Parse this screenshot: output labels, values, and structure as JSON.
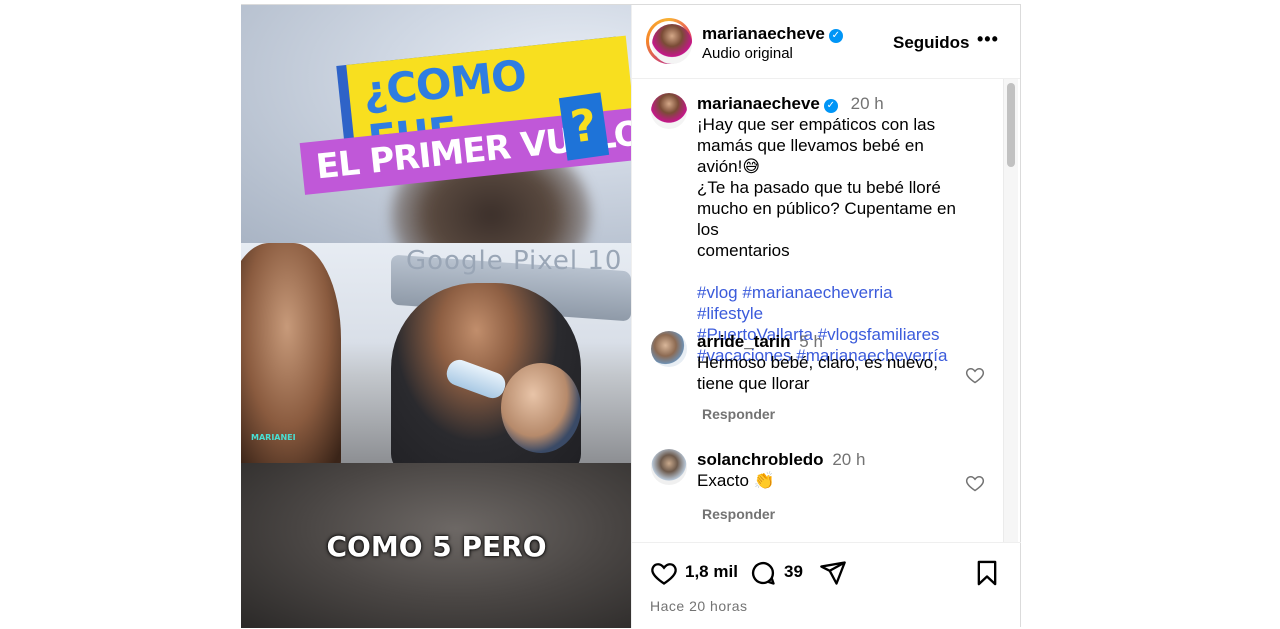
{
  "media": {
    "title_line1": "¿COMO FUE",
    "title_line2": "EL PRIMER VUELO DE LEO",
    "title_q": "?",
    "store_sign": "Google Pixel 10",
    "watermark": "MARIANEI",
    "caption_overlay": "COMO 5 PERO"
  },
  "header": {
    "username": "marianaecheve",
    "verified": true,
    "subtitle": "Audio original",
    "follow_label": "Seguidos",
    "more_icon": "more-horizontal-icon"
  },
  "caption": {
    "username": "marianaecheve",
    "time": "20 h",
    "text_lines": [
      "¡Hay que ser empáticos con las",
      "mamás que llevamos bebé en avión!😅",
      "¿Te ha pasado que tu bebé lloré",
      "mucho en público? Cupentame en los",
      "comentarios"
    ],
    "hashtag_lines": [
      [
        "#vlog",
        "#marianaecheverria",
        "#lifestyle"
      ],
      [
        "#PuertoVallarta",
        "#vlogsfamiliares"
      ],
      [
        "#vacaciones",
        "#marianaecheverría"
      ]
    ]
  },
  "comments": [
    {
      "username": "arride_tarin",
      "time": "5 h",
      "lines": [
        "Hermoso bebé, claro, es nuevo,",
        "tiene que llorar"
      ],
      "reply_label": "Responder"
    },
    {
      "username": "solanchrobledo",
      "time": "20 h",
      "lines": [
        "Exacto 👏"
      ],
      "reply_label": "Responder"
    }
  ],
  "actions": {
    "likes": "1,8 mil",
    "comments": "39",
    "posted_ago": "Hace 20 horas"
  },
  "colors": {
    "verified": "#0095f6",
    "hashtag": "#3b5bdb",
    "muted": "#737373",
    "title_yellow": "#f8df1f",
    "title_purple": "#c058d8",
    "title_blue": "#2f7de1"
  }
}
